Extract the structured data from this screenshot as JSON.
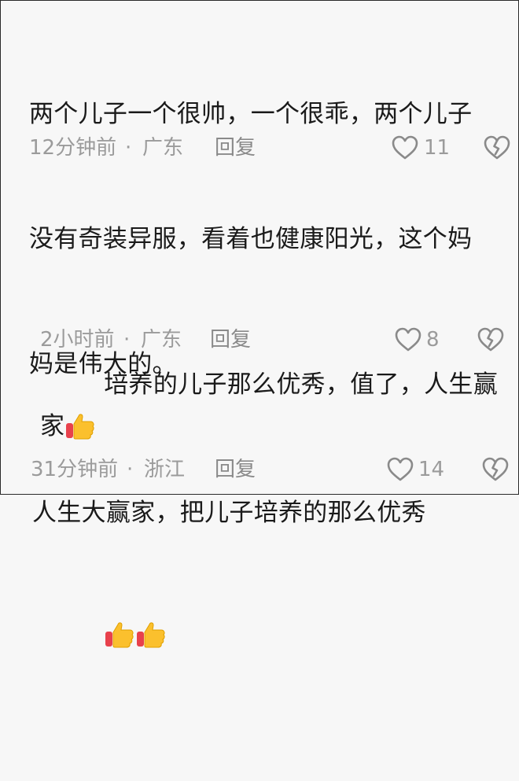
{
  "comments": [
    {
      "lines": [
        "两个儿子一个很帅，一个很乖，两个儿子",
        "没有奇装异服，看着也健康阳光，这个妈",
        "妈是伟大的。"
      ],
      "time": "12分钟前",
      "location": "广东",
      "reply": "回复",
      "likes": "11"
    },
    {
      "line1": "培养的儿子那么优秀，值了，人生赢家",
      "emoji": "thumbs-up",
      "time": "2小时前",
      "location": "广东",
      "reply": "回复",
      "likes": "8"
    },
    {
      "lines": [
        "人生大赢家，把儿子培养的那么优秀"
      ],
      "time": "31分钟前",
      "location": "浙江",
      "reply": "回复",
      "likes": "14"
    }
  ],
  "separator": "·",
  "icons": {
    "like": "heart-outline-icon",
    "dislike": "broken-heart-icon",
    "emoji": "thumbs-up-emoji"
  },
  "colors": {
    "text": "#1a1a1a",
    "meta": "#9b9b9b",
    "background": "#f7f7f7"
  }
}
